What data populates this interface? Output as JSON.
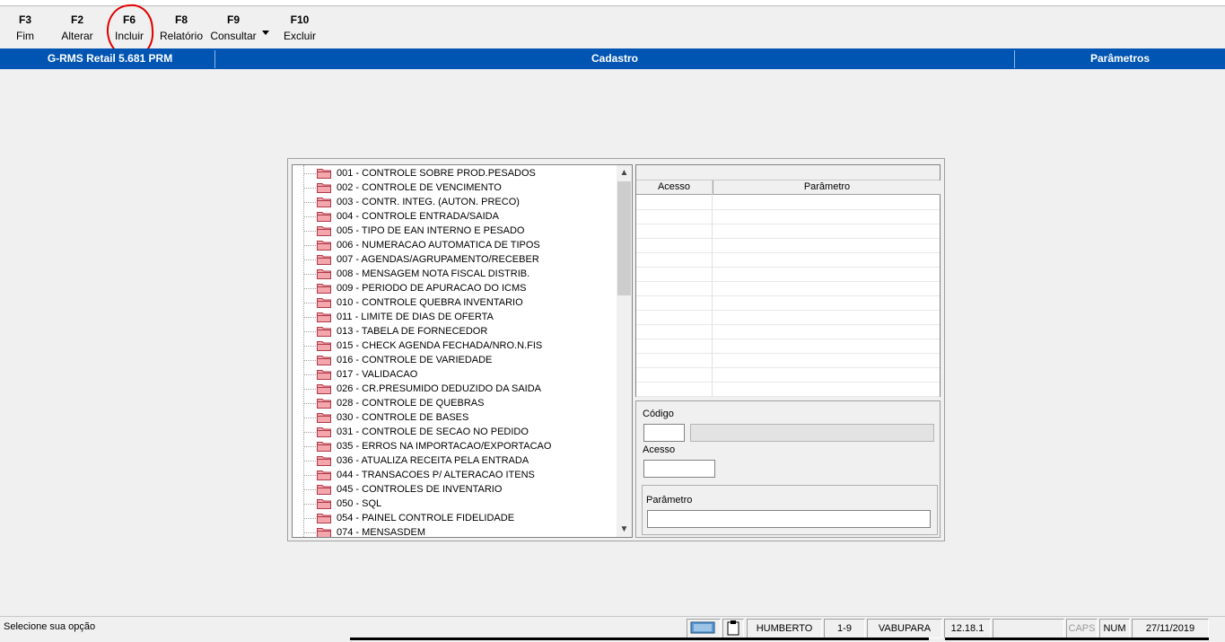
{
  "toolbar": {
    "buttons": [
      {
        "key": "F3",
        "label": "Fim"
      },
      {
        "key": "F2",
        "label": "Alterar"
      },
      {
        "key": "F6",
        "label": "Incluir"
      },
      {
        "key": "F8",
        "label": "Relatório"
      },
      {
        "key": "F9",
        "label": "Consultar"
      },
      {
        "key": "F10",
        "label": "Excluir"
      }
    ]
  },
  "titlebar": {
    "app": "G-RMS Retail 5.681 PRM",
    "module": "Cadastro",
    "screen": "Parâmetros",
    "color": "#0055b3"
  },
  "tree": {
    "items": [
      "001 - CONTROLE SOBRE PROD.PESADOS",
      "002 - CONTROLE DE VENCIMENTO",
      "003 - CONTR. INTEG. (AUTON. PRECO)",
      "004 - CONTROLE ENTRADA/SAIDA",
      "005 - TIPO DE EAN INTERNO E PESADO",
      "006 - NUMERACAO AUTOMATICA DE TIPOS",
      "007 - AGENDAS/AGRUPAMENTO/RECEBER",
      "008 - MENSAGEM NOTA FISCAL DISTRIB.",
      "009 - PERIODO DE APURACAO DO ICMS",
      "010 - CONTROLE QUEBRA INVENTARIO",
      "011 - LIMITE DE DIAS DE OFERTA",
      "013 - TABELA DE FORNECEDOR",
      "015 - CHECK AGENDA FECHADA/NRO.N.FIS",
      "016 - CONTROLE DE VARIEDADE",
      "017 - VALIDACAO",
      "026 - CR.PRESUMIDO DEDUZIDO DA SAIDA",
      "028 - CONTROLE DE QUEBRAS",
      "030 - CONTROLE DE BASES",
      "031 - CONTROLE DE SECAO NO PEDIDO",
      "035 - ERROS NA IMPORTACAO/EXPORTACAO",
      "036 - ATUALIZA RECEITA PELA ENTRADA",
      "044 - TRANSACOES P/ ALTERACAO ITENS",
      "045 - CONTROLES DE INVENTARIO",
      "050 - SQL",
      "054 - PAINEL CONTROLE FIDELIDADE",
      "074 - MENSASDEM"
    ],
    "folder_icon": "folder-icon",
    "folder_color": "#e8707a"
  },
  "grid": {
    "columns": [
      "Acesso",
      "Parâmetro"
    ]
  },
  "form": {
    "codigo_label": "Código",
    "acesso_label": "Acesso",
    "parametro_label": "Parâmetro"
  },
  "status": {
    "message": "Selecione sua opção",
    "user": "HUMBERTO",
    "range": "1-9",
    "store": "VABUPARA",
    "version": "12.18.1",
    "empty": "",
    "caps": "CAPS",
    "num": "NUM",
    "date": "27/11/2019"
  }
}
